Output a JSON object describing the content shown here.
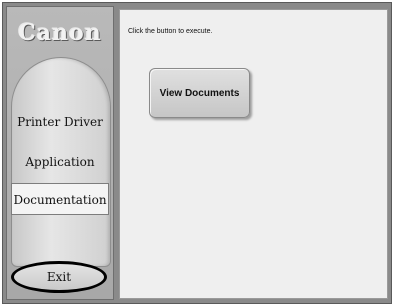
{
  "brand": {
    "logo_text": "Canon"
  },
  "nav": {
    "items": [
      {
        "label": "Printer Driver"
      },
      {
        "label": "Application"
      },
      {
        "label": "Documentation",
        "selected": true
      }
    ],
    "exit_label": "Exit"
  },
  "content": {
    "instruction": "Click the button to execute.",
    "view_documents_label": "View Documents"
  }
}
